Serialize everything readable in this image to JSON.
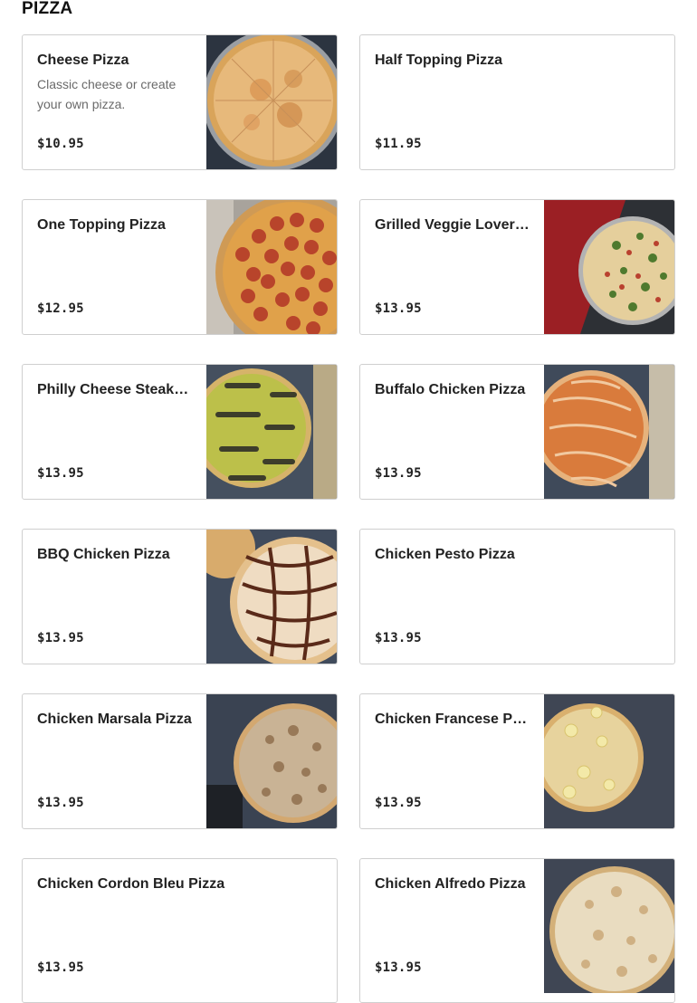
{
  "section": {
    "title": "PIZZA"
  },
  "items": [
    {
      "name": "Cheese Pizza",
      "description": "Classic cheese or create your own pizza.",
      "price": "$10.95",
      "image": "cheese-pizza-photo"
    },
    {
      "name": "Half Topping Pizza",
      "description": "",
      "price": "$11.95",
      "image": ""
    },
    {
      "name": "One Topping Pizza",
      "description": "",
      "price": "$12.95",
      "image": "pepperoni-pizza-photo"
    },
    {
      "name": "Grilled Veggie Lovers Pizza",
      "description": "",
      "price": "$13.95",
      "image": "veggie-pizza-photo"
    },
    {
      "name": "Philly Cheese Steak Pizza",
      "description": "",
      "price": "$13.95",
      "image": "philly-pizza-photo"
    },
    {
      "name": "Buffalo Chicken Pizza",
      "description": "",
      "price": "$13.95",
      "image": "buffalo-pizza-photo"
    },
    {
      "name": "BBQ Chicken Pizza",
      "description": "",
      "price": "$13.95",
      "image": "bbq-pizza-photo"
    },
    {
      "name": "Chicken Pesto Pizza",
      "description": "",
      "price": "$13.95",
      "image": ""
    },
    {
      "name": "Chicken Marsala Pizza",
      "description": "",
      "price": "$13.95",
      "image": "marsala-pizza-photo"
    },
    {
      "name": "Chicken Francese Pizza",
      "description": "",
      "price": "$13.95",
      "image": "francese-pizza-photo"
    },
    {
      "name": "Chicken Cordon Bleu Pizza",
      "description": "",
      "price": "$13.95",
      "image": ""
    },
    {
      "name": "Chicken Alfredo Pizza",
      "description": "",
      "price": "$13.95",
      "image": "alfredo-pizza-photo"
    }
  ],
  "colors": {
    "border": "#cfcfcf",
    "text": "#222222",
    "muted": "#6a6a6a"
  }
}
